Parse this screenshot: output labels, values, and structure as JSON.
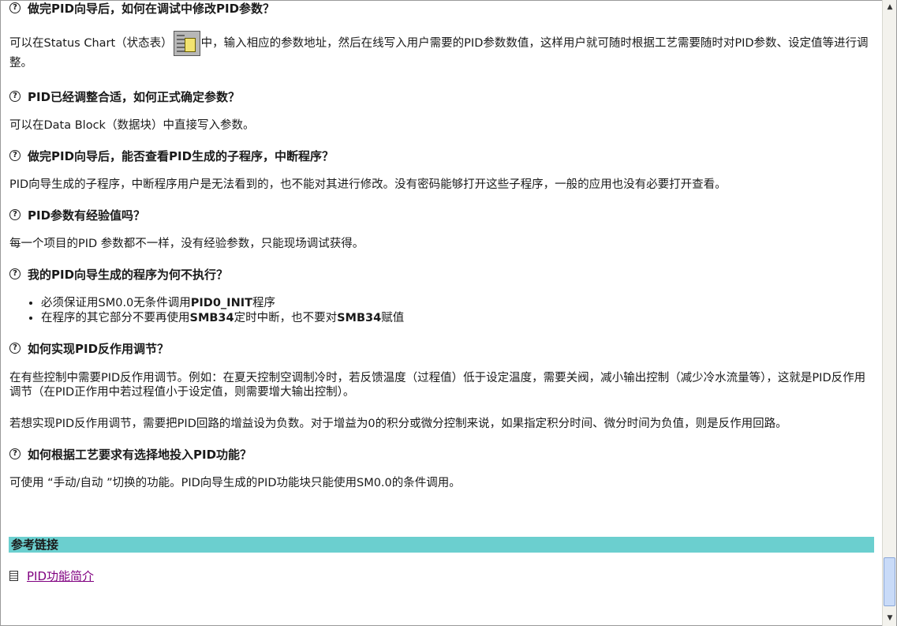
{
  "faq": [
    {
      "q": "做完PID向导后，如何在调试中修改PID参数？"
    },
    {
      "q": "PID已经调整合适，如何正式确定参数？",
      "a": "可以在Data Block（数据块）中直接写入参数。"
    },
    {
      "q": "做完PID向导后，能否查看PID生成的子程序，中断程序？",
      "a": "PID向导生成的子程序，中断程序用户是无法看到的，也不能对其进行修改。没有密码能够打开这些子程序，一般的应用也没有必要打开查看。"
    },
    {
      "q": "PID参数有经验值吗？",
      "a": "每一个项目的PID 参数都不一样，没有经验参数，只能现场调试获得。"
    },
    {
      "q": "我的PID向导生成的程序为何不执行？"
    },
    {
      "q": "如何实现PID反作用调节？",
      "a1": "在有些控制中需要PID反作用调节。例如：在夏天控制空调制冷时，若反馈温度（过程值）低于设定温度，需要关阀，减小输出控制（减少冷水流量等），这就是PID反作用调节（在PID正作用中若过程值小于设定值，则需要增大输出控制）。",
      "a2": "若想实现PID反作用调节，需要把PID回路的增益设为负数。对于增益为0的积分或微分控制来说，如果指定积分时间、微分时间为负值，则是反作用回路。"
    },
    {
      "q": "如何根据工艺要求有选择地投入PID功能？",
      "a": "可使用 “手动/自动 ”切换的功能。PID向导生成的PID功能块只能使用SM0.0的条件调用。"
    }
  ],
  "status_answer": {
    "pre": "可以在Status Chart（状态表）",
    "post": "中，输入相应的参数地址，然后在线写入用户需要的PID参数数值，这样用户就可随时根据工艺需要随时对PID参数、设定值等进行调整。"
  },
  "bullets": [
    {
      "t1": "必须保证用SM0.0无条件调用",
      "b1": "PID0_INIT",
      "t2": "程序"
    },
    {
      "t1": "在程序的其它部分不要再使用",
      "b1": "SMB34",
      "t2": "定时中断，也不要对",
      "b2": "SMB34",
      "t3": "赋值"
    }
  ],
  "refs": {
    "title": "参考链接",
    "link": "PID功能简介"
  },
  "q_icon": "?"
}
